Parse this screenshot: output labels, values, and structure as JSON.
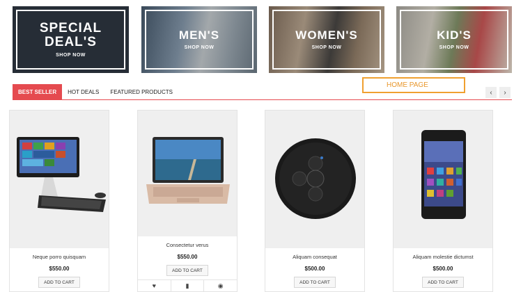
{
  "banners": [
    {
      "title": "SPECIAL DEAL'S",
      "cta": "SHOP NOW"
    },
    {
      "title": "MEN'S",
      "cta": "SHOP NOW"
    },
    {
      "title": "WOMEN'S",
      "cta": "SHOP NOW"
    },
    {
      "title": "KID'S",
      "cta": "SHOP NOW"
    }
  ],
  "tabs": [
    "BEST SELLER",
    "HOT DEALS",
    "FEATURED PRODUCTS"
  ],
  "annotation": "HOME PAGE",
  "nav": {
    "prev": "‹",
    "next": "›"
  },
  "products": [
    {
      "name": "Neque porro quisquam",
      "price": "$550.00",
      "cart": "ADD TO CART",
      "icon": "desktop-computer"
    },
    {
      "name": "Consectetur verus",
      "price": "$550.00",
      "cart": "ADD TO CART",
      "icon": "laptop"
    },
    {
      "name": "Aliquam consequat",
      "price": "$500.00",
      "cart": "ADD TO CART",
      "icon": "smart-speaker"
    },
    {
      "name": "Aliquam molestie dictumst",
      "price": "$500.00",
      "cart": "ADD TO CART",
      "icon": "smartphone"
    }
  ],
  "card_actions": {
    "wishlist": "♥",
    "compare": "▮",
    "quickview": "◉"
  }
}
